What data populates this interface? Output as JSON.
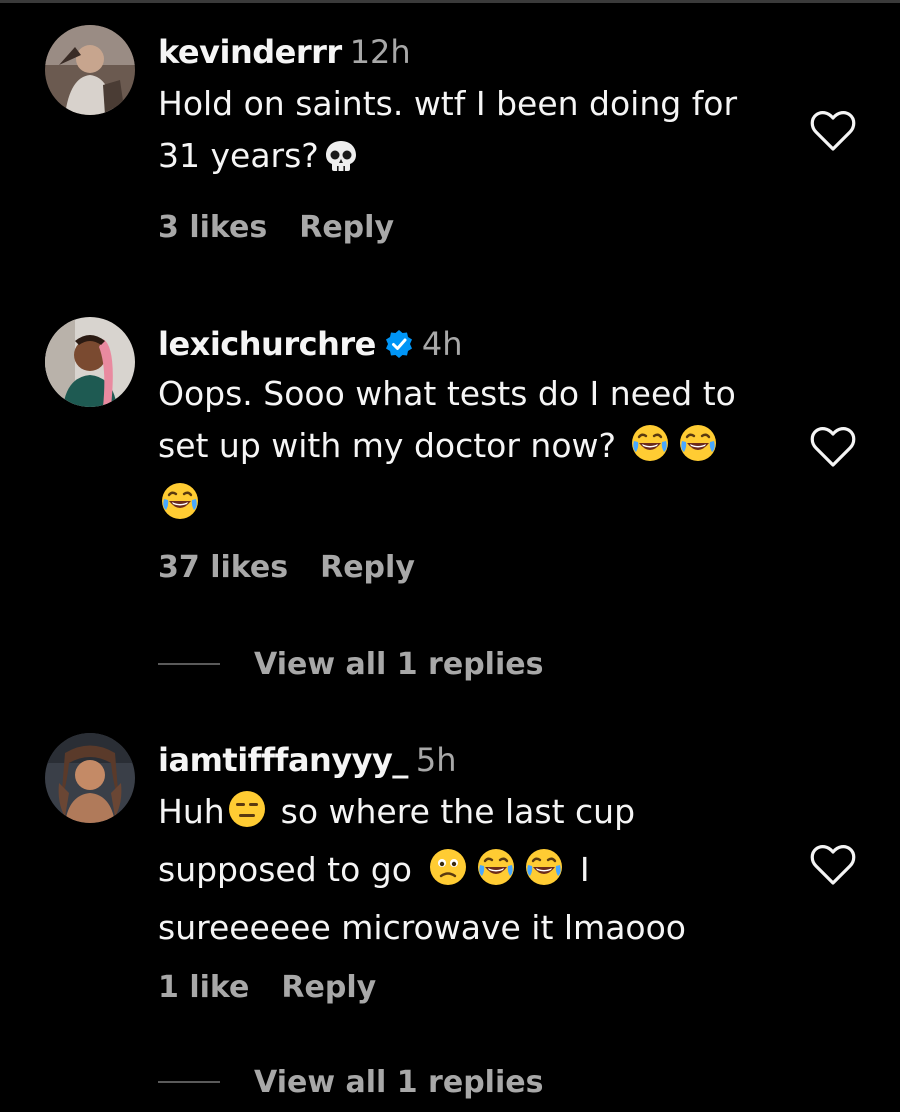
{
  "comments": [
    {
      "username": "kevinderrr",
      "time": "12h",
      "verified": false,
      "lines": [
        "Hold on saints. wtf I been doing for",
        "31 years?"
      ],
      "emojis": [
        "skull"
      ],
      "likes": "3 likes",
      "reply_label": "Reply"
    },
    {
      "username": "lexichurchre",
      "time": "4h",
      "verified": true,
      "lines": [
        "Oops. Sooo what tests do I need to",
        "set up with my doctor now?"
      ],
      "emojis": [
        "face-with-tears-of-joy",
        "face-with-tears-of-joy",
        "face-with-tears-of-joy"
      ],
      "likes": "37 likes",
      "reply_label": "Reply",
      "view_replies": "View all 1 replies"
    },
    {
      "username": "iamtifffanyyy_",
      "time": "5h",
      "verified": false,
      "lines": [
        "Huh",
        "so where the last cup",
        "supposed to go",
        "I",
        "sureeeeee microwave it lmaooo"
      ],
      "emojis": [
        "expressionless-face",
        "confused-face",
        "face-with-tears-of-joy",
        "face-with-tears-of-joy"
      ],
      "likes": "1 like",
      "reply_label": "Reply",
      "view_replies": "View all 1 replies"
    }
  ],
  "colors": {
    "background": "#000000",
    "text": "#f5f5f5",
    "secondary": "#a8a8a8",
    "verified": "#0095f6",
    "emoji_yellow": "#ffcc33"
  }
}
